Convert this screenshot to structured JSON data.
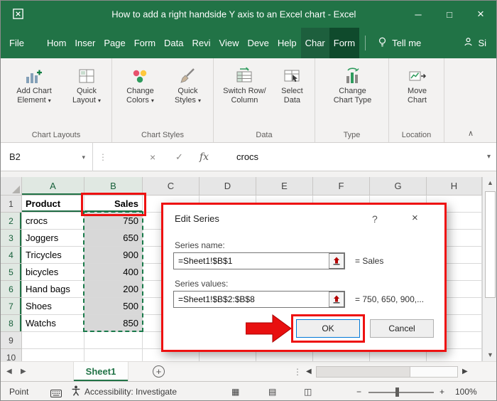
{
  "titlebar": {
    "title": "How to add a right handside Y axis to an Excel chart  -  Excel",
    "minimize_glyph": "─",
    "maximize_glyph": "□",
    "close_glyph": "×"
  },
  "tabs": {
    "file": "File",
    "items": [
      "Hom",
      "Inser",
      "Page",
      "Form",
      "Data",
      "Revi",
      "View",
      "Deve",
      "Help"
    ],
    "chart": "Char",
    "format": "Form",
    "tell_me": "Tell me",
    "share": "Si"
  },
  "ribbon": {
    "groups": [
      {
        "label": "Chart Layouts",
        "buttons": [
          {
            "l1": "Add Chart",
            "l2": "Element",
            "caret": "▾"
          },
          {
            "l1": "Quick",
            "l2": "Layout",
            "caret": "▾"
          }
        ]
      },
      {
        "label": "Chart Styles",
        "buttons": [
          {
            "l1": "Change",
            "l2": "Colors",
            "caret": "▾"
          },
          {
            "l1": "Quick",
            "l2": "Styles",
            "caret": "▾"
          }
        ]
      },
      {
        "label": "Data",
        "buttons": [
          {
            "l1": "Switch Row/",
            "l2": "Column",
            "caret": ""
          },
          {
            "l1": "Select",
            "l2": "Data",
            "caret": ""
          }
        ]
      },
      {
        "label": "Type",
        "buttons": [
          {
            "l1": "Change",
            "l2": "Chart Type",
            "caret": ""
          }
        ]
      },
      {
        "label": "Location",
        "buttons": [
          {
            "l1": "Move",
            "l2": "Chart",
            "caret": ""
          }
        ]
      }
    ],
    "collapse_glyph": "∧"
  },
  "formula_bar": {
    "name_box": "B2",
    "dropdown_glyph": "▾",
    "cancel_glyph": "×",
    "enter_glyph": "✓",
    "fx_label": "fx",
    "value": "crocs",
    "expand_glyph": "▾"
  },
  "grid": {
    "columns": [
      "A",
      "B",
      "C",
      "D",
      "E",
      "F",
      "G",
      "H"
    ],
    "row_numbers": [
      "1",
      "2",
      "3",
      "4",
      "5",
      "6",
      "7",
      "8",
      "9",
      "10"
    ],
    "rows": [
      {
        "a": "Product",
        "b": "Sales"
      },
      {
        "a": "crocs",
        "b": "750"
      },
      {
        "a": "Joggers",
        "b": "650"
      },
      {
        "a": "Tricycles",
        "b": "900"
      },
      {
        "a": "bicycles",
        "b": "400"
      },
      {
        "a": "Hand bags",
        "b": "200"
      },
      {
        "a": "Shoes",
        "b": "500"
      },
      {
        "a": "Watchs",
        "b": "850"
      }
    ]
  },
  "dialog": {
    "title": "Edit Series",
    "help_glyph": "?",
    "close_glyph": "×",
    "name_label": "Series name:",
    "name_value": "=Sheet1!$B$1",
    "name_result": "= Sales",
    "values_label": "Series values:",
    "values_value": "=Sheet1!$B$2:$B$8",
    "values_result": "= 750, 650, 900,...",
    "ok_label": "OK",
    "cancel_label": "Cancel"
  },
  "sheet_bar": {
    "nav_left": "◀",
    "nav_right": "▶",
    "tab": "Sheet1",
    "add_glyph": "+",
    "handle_glyph": "⋮",
    "hscroll_left": "◀",
    "hscroll_right": "▶"
  },
  "status_bar": {
    "mode": "Point",
    "accessibility": "Accessibility: Investigate",
    "view_normal_glyph": "▦",
    "view_layout_glyph": "▤",
    "view_break_glyph": "◫",
    "zoom_out_glyph": "−",
    "zoom_in_glyph": "+",
    "zoom_level": "100%"
  },
  "scroll": {
    "up": "▲",
    "down": "▼"
  },
  "colors": {
    "excel_green": "#217346",
    "annotation_red": "#ee1111",
    "focus_blue": "#0078d7",
    "selection_fill": "#d8d8d8",
    "selection_dash_green": "#1a7a4a"
  }
}
